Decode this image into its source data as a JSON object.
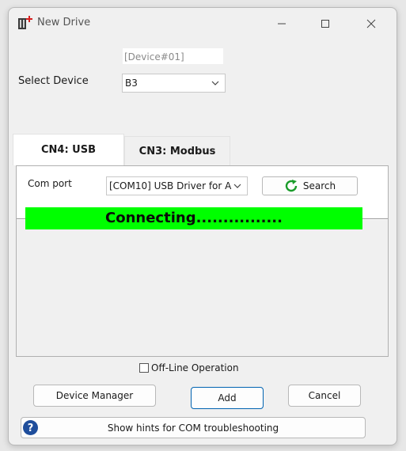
{
  "window": {
    "title": "New Drive",
    "icons": {
      "app": "drive-plus-icon",
      "minimize": "minimize-icon",
      "maximize": "maximize-icon",
      "close": "close-icon"
    }
  },
  "device": {
    "id_value": "[Device#01]",
    "select_label": "Select Device",
    "selected": "B3"
  },
  "tabs": [
    {
      "label": "CN4: USB",
      "active": true
    },
    {
      "label": "CN3: Modbus",
      "active": false
    }
  ],
  "usb": {
    "com_label": "Com port",
    "com_value": "[COM10] USB Driver for A",
    "search_label": "Search",
    "status_text": "Connecting................",
    "status_color": "#00ff00"
  },
  "options": {
    "offline_label": "Off-Line Operation",
    "offline_checked": false
  },
  "buttons": {
    "device_manager": "Device Manager",
    "add": "Add",
    "cancel": "Cancel",
    "hints": "Show hints for COM troubleshooting"
  },
  "colors": {
    "accent": "#0063b1",
    "search_icon": "#1a9c2a",
    "help_icon": "#1f4e9c",
    "app_icon_plus": "#d62020"
  }
}
